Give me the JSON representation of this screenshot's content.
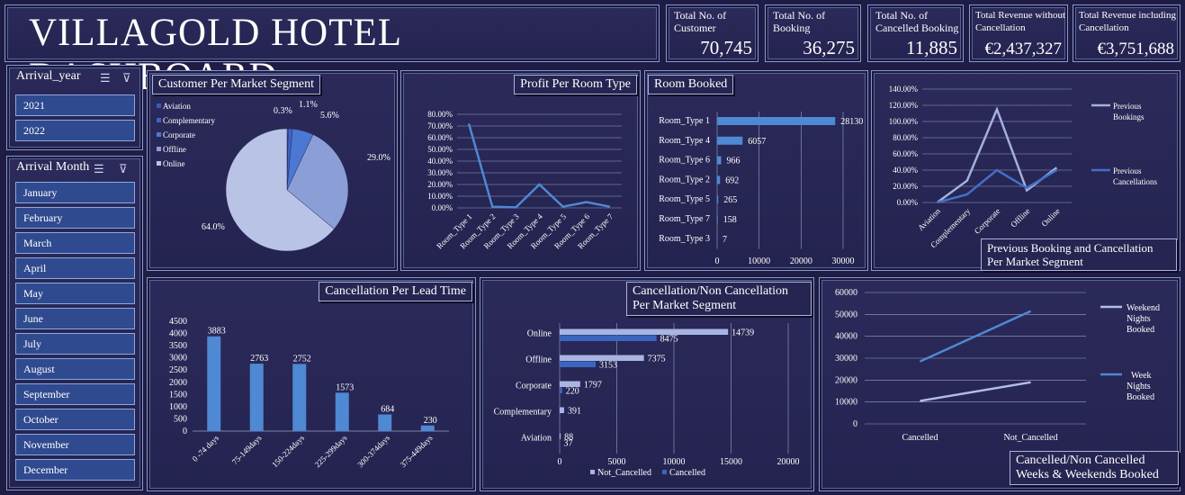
{
  "header": {
    "title": "VILLAGOLD HOTEL DASHBOARD"
  },
  "kpis": [
    {
      "label": "Total No. of Customer",
      "value": "70,745"
    },
    {
      "label": "Total No. of Booking",
      "value": "36,275"
    },
    {
      "label": "Total No. of Cancelled Booking",
      "value": "11,885"
    },
    {
      "label": "Total Revenue without Cancellation",
      "value": "€2,437,327"
    },
    {
      "label": "Total Revenue including Cancellation",
      "value": "€3,751,688"
    }
  ],
  "slicers": {
    "year": {
      "title": "Arrival_year",
      "items": [
        "2021",
        "2022"
      ]
    },
    "month": {
      "title": "Arrival Month",
      "items": [
        "January",
        "February",
        "March",
        "April",
        "May",
        "June",
        "July",
        "August",
        "September",
        "October",
        "November",
        "December"
      ]
    }
  },
  "colors": {
    "light": "#b9c3e6",
    "mid": "#8b9ed6",
    "accent": "#4a7fd0",
    "dark": "#3458a8",
    "bar": "#4f88d3",
    "grid": "#9aa3c8"
  },
  "chart_data": [
    {
      "id": "market_segment_pie",
      "type": "pie",
      "title": "Customer Per Market Segment",
      "categories": [
        "Aviation",
        "Complementary",
        "Corporate",
        "Offline",
        "Online"
      ],
      "values": [
        0.3,
        1.1,
        5.6,
        29.0,
        64.0
      ],
      "labels": [
        "0.3%",
        "1.1%",
        "5.6%",
        "29.0%",
        "64.0%"
      ],
      "colors": [
        "#3a5ab8",
        "#3e63c4",
        "#4a78d2",
        "#8b9ed6",
        "#b9c3e6"
      ],
      "legend": "left"
    },
    {
      "id": "profit_room_type",
      "type": "line",
      "title": "Profit Per Room Type",
      "categories": [
        "Room_Type 1",
        "Room_Type 2",
        "Room_Type 3",
        "Room_Type 4",
        "Room_Type 5",
        "Room_Type 6",
        "Room_Type 7"
      ],
      "values": [
        72.0,
        1.0,
        0.5,
        20.0,
        1.0,
        5.0,
        1.0
      ],
      "yticks": [
        "0.00%",
        "10.00%",
        "20.00%",
        "30.00%",
        "40.00%",
        "50.00%",
        "60.00%",
        "70.00%",
        "80.00%"
      ],
      "ylim": [
        0,
        80
      ],
      "grid": true
    },
    {
      "id": "room_booked",
      "type": "bar",
      "title": "Room Booked",
      "categories": [
        "Room_Type 1",
        "Room_Type 4",
        "Room_Type 6",
        "Room_Type 2",
        "Room_Type 5",
        "Room_Type 7",
        "Room_Type 3"
      ],
      "values": [
        28130,
        6057,
        966,
        692,
        265,
        158,
        7
      ],
      "xticks": [
        "0",
        "10000",
        "20000",
        "30000"
      ],
      "xlim": [
        0,
        30000
      ],
      "grid": true
    },
    {
      "id": "prev_booking_segment",
      "type": "line",
      "title": "Previous Booking and Cancellation Per Market Segment",
      "categories": [
        "Aviation",
        "Complementary",
        "Corporate",
        "Offline",
        "Online"
      ],
      "series": [
        {
          "name": "Previous Bookings",
          "values": [
            0,
            27,
            115,
            15,
            43
          ]
        },
        {
          "name": "Previous Cancellations",
          "values": [
            0,
            10,
            40,
            18,
            40
          ]
        }
      ],
      "yticks": [
        "0.00%",
        "20.00%",
        "40.00%",
        "60.00%",
        "80.00%",
        "100.00%",
        "120.00%",
        "140.00%"
      ],
      "ylim": [
        0,
        140
      ],
      "legend": "right",
      "grid": true
    },
    {
      "id": "cancel_lead_time",
      "type": "bar",
      "title": "Cancellation Per Lead Time",
      "categories": [
        "0 -74 days",
        "75-149days",
        "150-224days",
        "225-299days",
        "300-374days",
        "375-449days"
      ],
      "values": [
        3883,
        2763,
        2752,
        1573,
        684,
        230
      ],
      "yticks": [
        "0",
        "500",
        "1000",
        "1500",
        "2000",
        "2500",
        "3000",
        "3500",
        "4000",
        "4500"
      ],
      "ylim": [
        0,
        4500
      ]
    },
    {
      "id": "cancel_segment",
      "type": "bar",
      "title": "Cancellation/Non Cancellation Per Market Segment",
      "categories": [
        "Online",
        "Offline",
        "Corporate",
        "Complementary",
        "Aviation"
      ],
      "series": [
        {
          "name": "Not_Cancelled",
          "values": [
            14739,
            7375,
            1797,
            391,
            88
          ]
        },
        {
          "name": "Cancelled",
          "values": [
            8475,
            3153,
            220,
            0,
            37
          ]
        }
      ],
      "value_labels": [
        [
          "14739",
          "7375",
          "1797",
          "391",
          "88"
        ],
        [
          "8475",
          "3153",
          "220",
          "",
          "37"
        ]
      ],
      "xticks": [
        "0",
        "5000",
        "10000",
        "15000",
        "20000"
      ],
      "xlim": [
        0,
        20000
      ],
      "legend": "bottom",
      "grid": true
    },
    {
      "id": "week_weekend",
      "type": "line",
      "title": "Cancelled/Non Cancelled Weeks & Weekends Booked",
      "categories": [
        "Cancelled",
        "Not_Cancelled"
      ],
      "series": [
        {
          "name": "Weekend Nights Booked",
          "values": [
            10500,
            19000
          ]
        },
        {
          "name": "Week Nights Booked",
          "values": [
            28500,
            51500
          ]
        }
      ],
      "yticks": [
        "0",
        "10000",
        "20000",
        "30000",
        "40000",
        "50000",
        "60000"
      ],
      "ylim": [
        0,
        60000
      ],
      "legend": "right",
      "grid": true
    }
  ]
}
